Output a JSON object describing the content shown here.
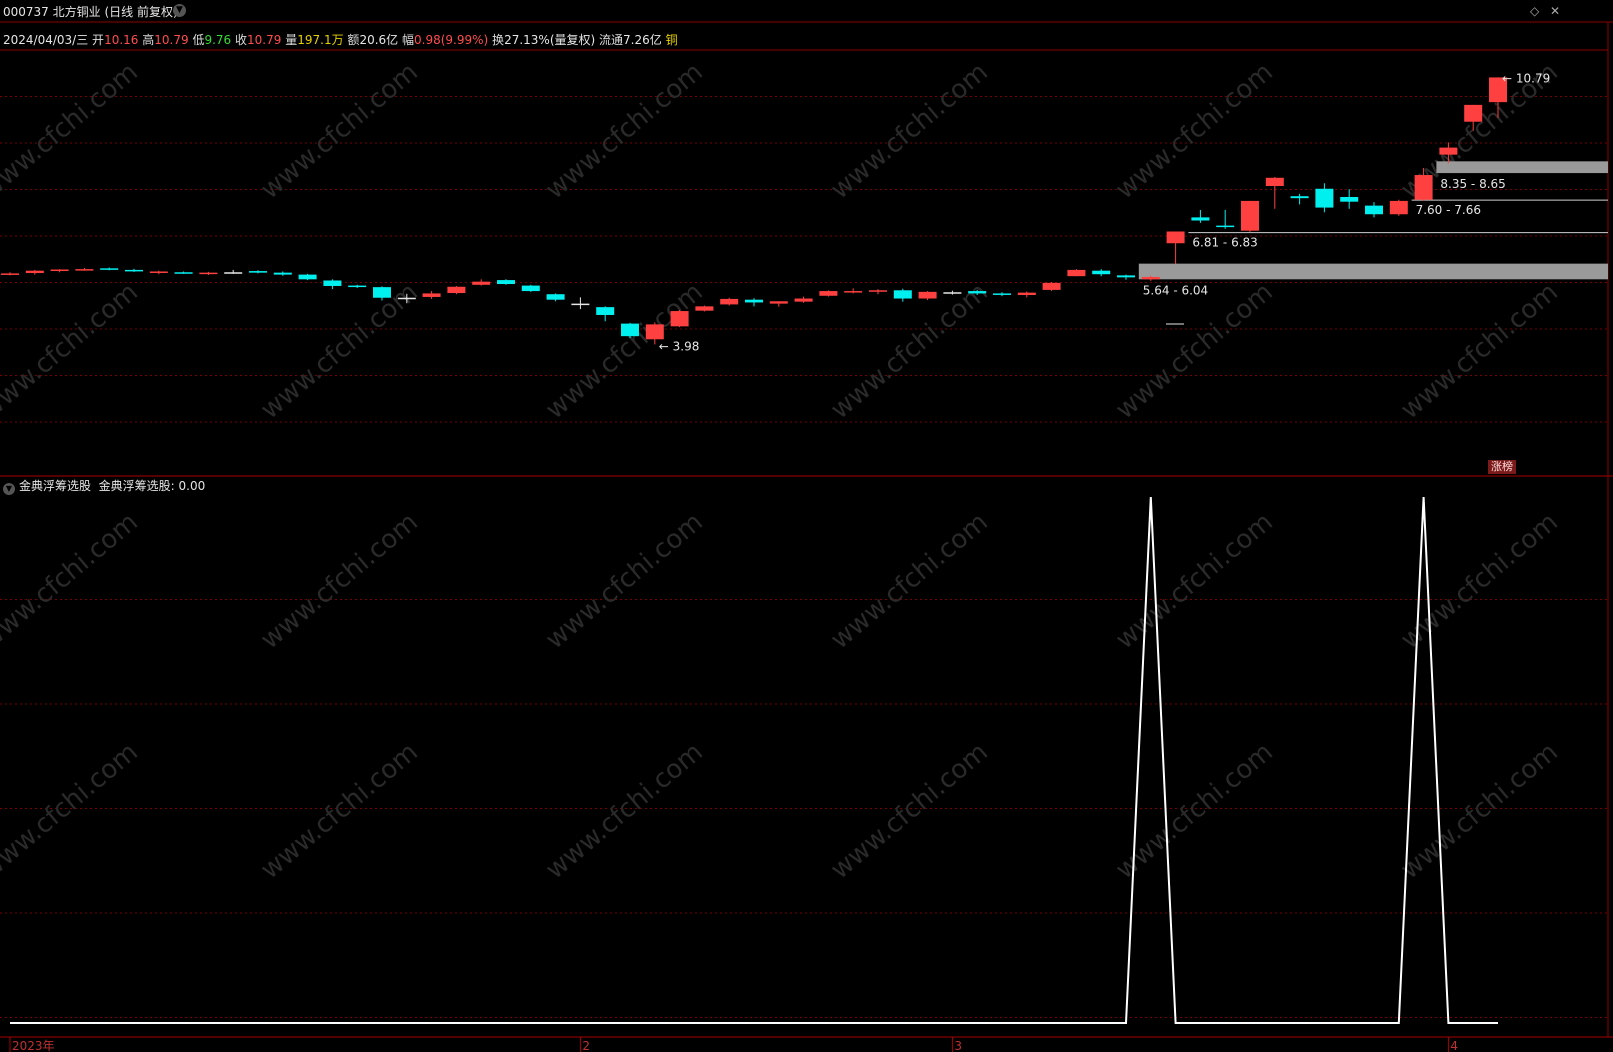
{
  "header": {
    "stock_code": "000737",
    "stock_name": "北方铜业",
    "period_mode": "(日线 前复权)",
    "dropdown_icon": "chevron-down-icon",
    "right_icons": [
      "diamond-icon",
      "close-icon"
    ]
  },
  "quote": {
    "date": "2024/04/03/三",
    "open_label": "开",
    "open": "10.16",
    "high_label": "高",
    "high": "10.79",
    "low_label": "低",
    "low": "9.76",
    "close_label": "收",
    "close": "10.79",
    "volume_label": "量",
    "volume": "197.1万",
    "amount_label": "额",
    "amount": "20.6亿",
    "change_label": "幅",
    "change": "0.98(9.99%)",
    "turnover_label": "换",
    "turnover": "27.13%(量复权)",
    "float_label": "流通",
    "float": "7.26亿",
    "sector": "铜"
  },
  "indicator": {
    "name": "金典浮筹选股",
    "value_text": "金典浮筹选股: 0.00"
  },
  "badge": "涨榜",
  "watermark": "www.cfchi.com",
  "colors": {
    "up": "#ff4040",
    "down": "#00f0f0",
    "flat": "#e6e6e6",
    "grid": "#7a0000",
    "band": "#9a9a9a",
    "indicator_line": "#ffffff"
  },
  "chart_data": [
    {
      "type": "candlestick",
      "title": "",
      "x_labels": [
        "2023年",
        "2",
        "3",
        "4"
      ],
      "x_label_candle_index": [
        0,
        23,
        38,
        58
      ],
      "ylim": [
        3.5,
        11.0
      ],
      "annotations": [
        {
          "text": "10.79",
          "kind": "high-marker",
          "candle": 60
        },
        {
          "text": "3.98",
          "kind": "low-marker",
          "candle": 26
        }
      ],
      "bands": [
        {
          "label": "8.35 - 8.65",
          "low": 8.35,
          "high": 8.65,
          "style": "filled",
          "from_candle": 58
        },
        {
          "label": "7.60 - 7.66",
          "low": 7.6,
          "high": 7.66,
          "style": "line",
          "from_candle": 57
        },
        {
          "label": "6.81 - 6.83",
          "low": 6.81,
          "high": 6.83,
          "style": "line",
          "from_candle": 48
        },
        {
          "label": "5.64 - 6.04",
          "low": 5.64,
          "high": 6.04,
          "style": "filled",
          "from_candle": 46
        }
      ],
      "candles": [
        {
          "o": 5.78,
          "h": 5.82,
          "l": 5.74,
          "c": 5.79
        },
        {
          "o": 5.8,
          "h": 5.88,
          "l": 5.76,
          "c": 5.86
        },
        {
          "o": 5.86,
          "h": 5.9,
          "l": 5.82,
          "c": 5.89
        },
        {
          "o": 5.89,
          "h": 5.93,
          "l": 5.86,
          "c": 5.9
        },
        {
          "o": 5.92,
          "h": 5.94,
          "l": 5.87,
          "c": 5.89
        },
        {
          "o": 5.88,
          "h": 5.91,
          "l": 5.83,
          "c": 5.85
        },
        {
          "o": 5.82,
          "h": 5.86,
          "l": 5.77,
          "c": 5.84
        },
        {
          "o": 5.82,
          "h": 5.84,
          "l": 5.78,
          "c": 5.79
        },
        {
          "o": 5.79,
          "h": 5.83,
          "l": 5.75,
          "c": 5.81
        },
        {
          "o": 5.82,
          "h": 5.88,
          "l": 5.78,
          "c": 5.82
        },
        {
          "o": 5.85,
          "h": 5.87,
          "l": 5.79,
          "c": 5.81
        },
        {
          "o": 5.81,
          "h": 5.84,
          "l": 5.73,
          "c": 5.76
        },
        {
          "o": 5.76,
          "h": 5.78,
          "l": 5.62,
          "c": 5.64
        },
        {
          "o": 5.61,
          "h": 5.64,
          "l": 5.39,
          "c": 5.47
        },
        {
          "o": 5.48,
          "h": 5.5,
          "l": 5.42,
          "c": 5.46
        },
        {
          "o": 5.44,
          "h": 5.46,
          "l": 5.1,
          "c": 5.17
        },
        {
          "o": 5.17,
          "h": 5.27,
          "l": 5.03,
          "c": 5.17
        },
        {
          "o": 5.19,
          "h": 5.34,
          "l": 5.14,
          "c": 5.28
        },
        {
          "o": 5.29,
          "h": 5.47,
          "l": 5.26,
          "c": 5.45
        },
        {
          "o": 5.5,
          "h": 5.64,
          "l": 5.48,
          "c": 5.58
        },
        {
          "o": 5.62,
          "h": 5.64,
          "l": 5.5,
          "c": 5.52
        },
        {
          "o": 5.48,
          "h": 5.5,
          "l": 5.32,
          "c": 5.34
        },
        {
          "o": 5.26,
          "h": 5.28,
          "l": 5.08,
          "c": 5.12
        },
        {
          "o": 5.02,
          "h": 5.18,
          "l": 4.88,
          "c": 5.02
        },
        {
          "o": 4.93,
          "h": 4.95,
          "l": 4.57,
          "c": 4.73
        },
        {
          "o": 4.51,
          "h": 4.53,
          "l": 4.14,
          "c": 4.19
        },
        {
          "o": 4.11,
          "h": 4.54,
          "l": 3.98,
          "c": 4.49
        },
        {
          "o": 4.44,
          "h": 4.86,
          "l": 4.42,
          "c": 4.83
        },
        {
          "o": 4.84,
          "h": 4.97,
          "l": 4.82,
          "c": 4.95
        },
        {
          "o": 5.0,
          "h": 5.17,
          "l": 4.97,
          "c": 5.14
        },
        {
          "o": 5.12,
          "h": 5.16,
          "l": 4.95,
          "c": 5.05
        },
        {
          "o": 5.02,
          "h": 5.08,
          "l": 4.94,
          "c": 5.08
        },
        {
          "o": 5.07,
          "h": 5.2,
          "l": 5.04,
          "c": 5.15
        },
        {
          "o": 5.22,
          "h": 5.36,
          "l": 5.2,
          "c": 5.34
        },
        {
          "o": 5.33,
          "h": 5.41,
          "l": 5.28,
          "c": 5.34
        },
        {
          "o": 5.34,
          "h": 5.39,
          "l": 5.26,
          "c": 5.36
        },
        {
          "o": 5.36,
          "h": 5.4,
          "l": 5.07,
          "c": 5.15
        },
        {
          "o": 5.15,
          "h": 5.34,
          "l": 5.11,
          "c": 5.32
        },
        {
          "o": 5.31,
          "h": 5.35,
          "l": 5.25,
          "c": 5.31
        },
        {
          "o": 5.34,
          "h": 5.37,
          "l": 5.24,
          "c": 5.28
        },
        {
          "o": 5.28,
          "h": 5.31,
          "l": 5.21,
          "c": 5.27
        },
        {
          "o": 5.24,
          "h": 5.33,
          "l": 5.18,
          "c": 5.3
        },
        {
          "o": 5.37,
          "h": 5.57,
          "l": 5.34,
          "c": 5.55
        },
        {
          "o": 5.72,
          "h": 5.9,
          "l": 5.72,
          "c": 5.88
        },
        {
          "o": 5.86,
          "h": 5.9,
          "l": 5.72,
          "c": 5.77
        },
        {
          "o": 5.74,
          "h": 5.76,
          "l": 5.63,
          "c": 5.69
        },
        {
          "o": 5.64,
          "h": 5.73,
          "l": 5.6,
          "c": 5.7
        },
        {
          "o": 6.56,
          "h": 6.61,
          "l": 6.03,
          "c": 6.86
        },
        {
          "o": 7.22,
          "h": 7.41,
          "l": 7.08,
          "c": 7.14
        },
        {
          "o": 7.01,
          "h": 7.41,
          "l": 6.93,
          "c": 7.0
        },
        {
          "o": 6.88,
          "h": 7.64,
          "l": 6.85,
          "c": 7.64
        },
        {
          "o": 8.02,
          "h": 8.25,
          "l": 7.44,
          "c": 8.23
        },
        {
          "o": 7.76,
          "h": 7.82,
          "l": 7.55,
          "c": 7.71
        },
        {
          "o": 7.95,
          "h": 8.09,
          "l": 7.35,
          "c": 7.47
        },
        {
          "o": 7.74,
          "h": 7.94,
          "l": 7.44,
          "c": 7.62
        },
        {
          "o": 7.52,
          "h": 7.61,
          "l": 7.22,
          "c": 7.3
        },
        {
          "o": 7.3,
          "h": 7.67,
          "l": 7.26,
          "c": 7.64
        },
        {
          "o": 7.67,
          "h": 8.48,
          "l": 7.64,
          "c": 8.3
        },
        {
          "o": 8.82,
          "h": 9.13,
          "l": 8.6,
          "c": 9.0
        },
        {
          "o": 9.66,
          "h": 10.09,
          "l": 9.43,
          "c": 10.09
        },
        {
          "o": 10.16,
          "h": 10.79,
          "l": 9.76,
          "c": 10.79
        }
      ]
    },
    {
      "type": "line",
      "title": "金典浮筹选股",
      "ylim": [
        0,
        1
      ],
      "x": [
        0,
        45,
        46,
        47,
        56,
        57,
        58,
        60
      ],
      "y": [
        0,
        0,
        1,
        0,
        0,
        1,
        0,
        0
      ]
    }
  ]
}
